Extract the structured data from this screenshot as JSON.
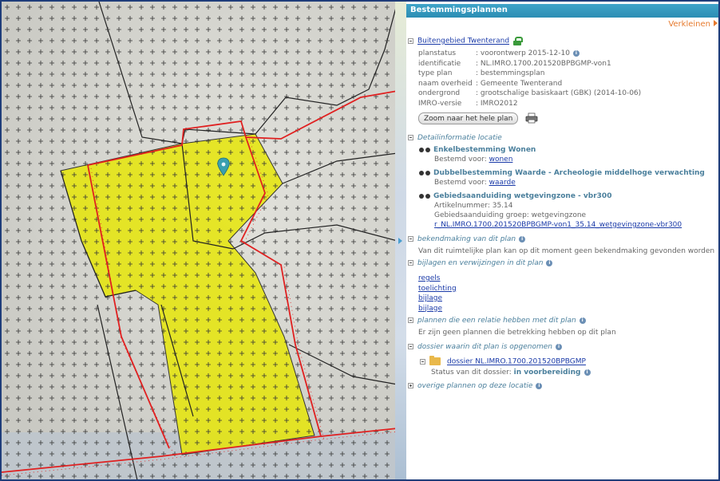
{
  "panel": {
    "title": "Bestemmingsplannen",
    "collapse_label": "Verkleinen"
  },
  "plan": {
    "name": "Buitengebied Twenterand",
    "fields": [
      {
        "label": "planstatus",
        "value": ": voorontwerp 2015-12-10"
      },
      {
        "label": "identificatie",
        "value": ": NL.IMRO.1700.201520BPBGMP-von1"
      },
      {
        "label": "type plan",
        "value": ": bestemmingsplan"
      },
      {
        "label": "naam overheid",
        "value": ": Gemeente Twenterand"
      },
      {
        "label": "ondergrond",
        "value": ": grootschalige basiskaart (GBK) (2014-10-06)"
      },
      {
        "label": "IMRO-versie",
        "value": ": IMRO2012"
      }
    ],
    "zoom_button": "Zoom naar het hele plan"
  },
  "detail": {
    "title": "Detailinformatie locatie",
    "items": [
      {
        "name": "Enkelbestemming Wonen",
        "sub_label": "Bestemd voor:",
        "sub_link": "wonen"
      },
      {
        "name": "Dubbelbestemming Waarde - Archeologie middelhoge verwachting",
        "sub_label": "Bestemd voor:",
        "sub_link": "waarde"
      }
    ],
    "area": {
      "name": "Gebiedsaanduiding wetgevingzone - vbr300",
      "line1": "Artikelnummer: 35.14",
      "line2": "Gebiedsaanduiding groep: wetgevingzone",
      "link": "r_NL.IMRO.1700.201520BPBGMP-von1_35.14_wetgevingzone-vbr300"
    }
  },
  "bekendmaking": {
    "title": "bekendmaking van dit plan",
    "text": "Van dit ruimtelijke plan kan op dit moment geen bekendmaking gevonden worden"
  },
  "bijlagen": {
    "title": "bijlagen en verwijzingen in dit plan",
    "links": [
      "regels",
      "toelichting",
      "bijlage",
      "bijlage"
    ]
  },
  "relaties": {
    "title": "plannen die een relatie hebben met dit plan",
    "text": "Er zijn geen plannen die betrekking hebben op dit plan"
  },
  "dossier": {
    "title": "dossier waarin dit plan is opgenomen",
    "link": "dossier NL.IMRO.1700.201520BPBGMP",
    "status_label": "Status van dit dossier:",
    "status_value": "in voorbereiding"
  },
  "overige": {
    "title": "overige plannen op deze locatie"
  },
  "colors": {
    "header": "#2b8db3",
    "plan_fill": "#e6e600",
    "plan_border": "#e02020",
    "link": "#1a3aa8",
    "accent": "#e67a2e",
    "marker": "#3aa0b0"
  },
  "icons": [
    "lock-icon",
    "info-icon",
    "binoculars-icon",
    "print-icon",
    "folder-icon",
    "map-marker-icon",
    "expand-icon",
    "collapse-icon"
  ]
}
